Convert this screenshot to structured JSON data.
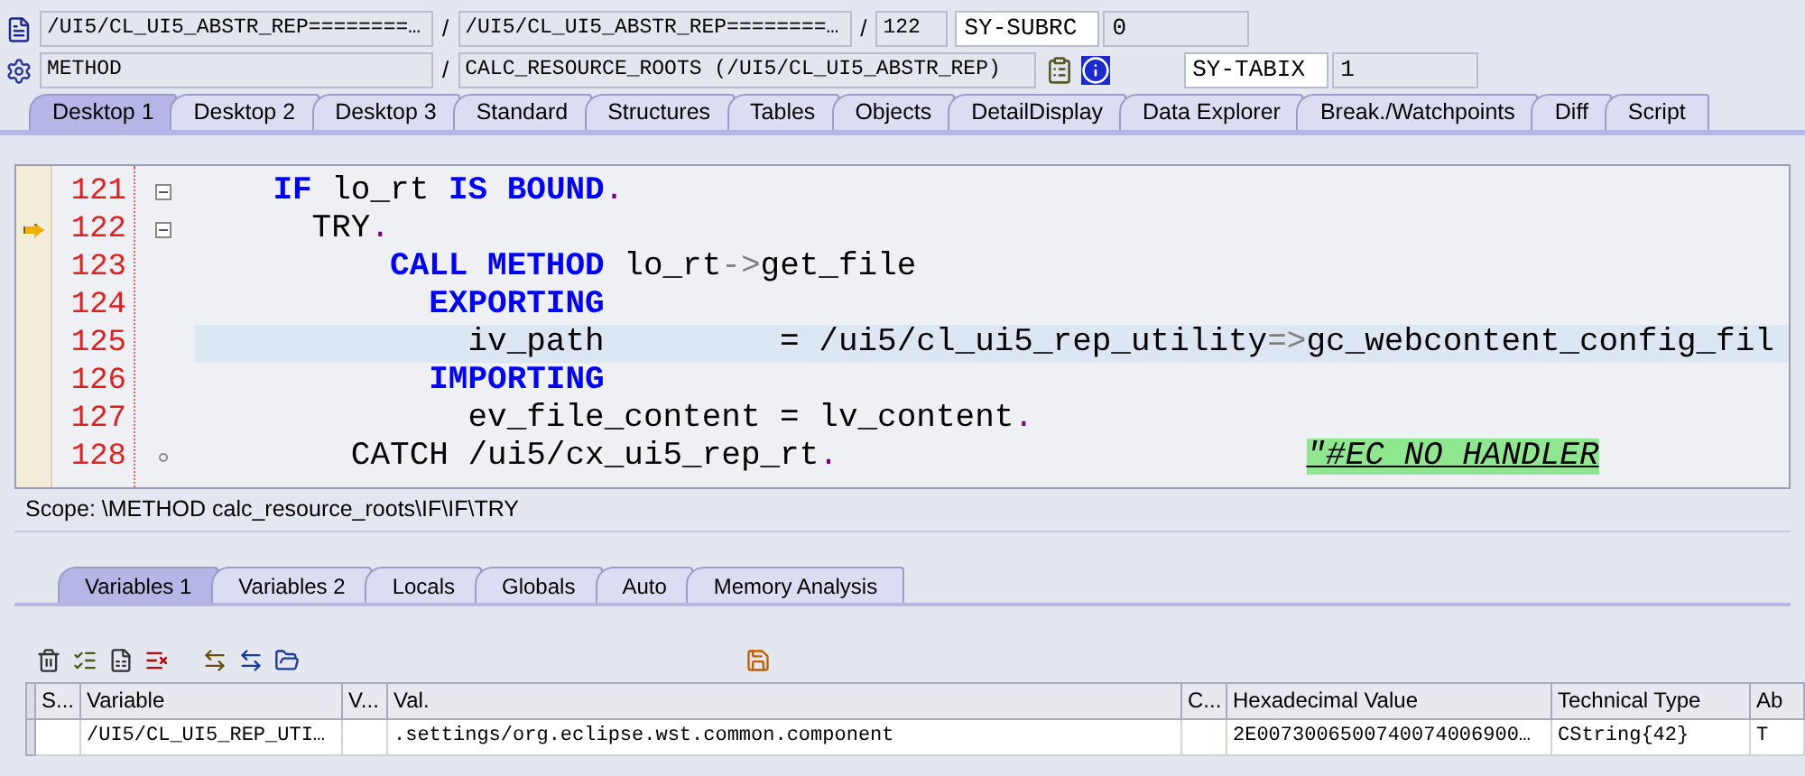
{
  "header": {
    "row1": [
      {
        "kind": "field",
        "text": "/UI5/CL_UI5_ABSTR_REP========…"
      },
      {
        "kind": "sep",
        "text": "/"
      },
      {
        "kind": "field",
        "text": "/UI5/CL_UI5_ABSTR_REP========…"
      },
      {
        "kind": "sep",
        "text": "/"
      },
      {
        "kind": "short",
        "text": "122"
      }
    ],
    "row2": [
      {
        "kind": "field",
        "text": "METHOD"
      },
      {
        "kind": "sep",
        "text": "/"
      },
      {
        "kind": "wide",
        "text": "CALC_RESOURCE_ROOTS (/UI5/CL_UI5_ABSTR_REP)"
      }
    ],
    "sysvars": [
      {
        "name": "SY-SUBRC",
        "value": "0"
      },
      {
        "name": "SY-TABIX",
        "value": "1"
      }
    ]
  },
  "tabs": [
    {
      "label": "Desktop 1",
      "selected": true
    },
    {
      "label": "Desktop 2",
      "selected": false
    },
    {
      "label": "Desktop 3",
      "selected": false
    },
    {
      "label": "Standard",
      "selected": false
    },
    {
      "label": "Structures",
      "selected": false
    },
    {
      "label": "Tables",
      "selected": false
    },
    {
      "label": "Objects",
      "selected": false
    },
    {
      "label": "DetailDisplay",
      "selected": false
    },
    {
      "label": "Data Explorer",
      "selected": false
    },
    {
      "label": "Break./Watchpoints",
      "selected": false
    },
    {
      "label": "Diff",
      "selected": false
    },
    {
      "label": "Script",
      "selected": false
    }
  ],
  "editor": {
    "lines": [
      {
        "number": "121",
        "highlighted": false,
        "foldable": true,
        "tokens": [
          {
            "kind": "kw",
            "text": "    IF"
          },
          {
            "kind": "id",
            "text": " lo_rt "
          },
          {
            "kind": "kw",
            "text": "IS BOUND"
          },
          {
            "kind": "dot",
            "text": "."
          }
        ]
      },
      {
        "number": "122",
        "current": true,
        "highlighted": false,
        "foldable": true,
        "tokens": [
          {
            "kind": "id",
            "text": "      TRY"
          },
          {
            "kind": "dot",
            "text": "."
          }
        ]
      },
      {
        "number": "123",
        "highlighted": false,
        "tokens": [
          {
            "kind": "kw",
            "text": "          CALL METHOD"
          },
          {
            "kind": "id",
            "text": " lo_rt"
          },
          {
            "kind": "op",
            "text": "->"
          },
          {
            "kind": "id",
            "text": "get_file"
          }
        ]
      },
      {
        "number": "124",
        "highlighted": false,
        "tokens": [
          {
            "kind": "kw",
            "text": "            EXPORTING"
          }
        ]
      },
      {
        "number": "125",
        "highlighted": true,
        "tokens": [
          {
            "kind": "id",
            "text": "              iv_path         = /ui5/cl_ui5_rep_utility"
          },
          {
            "kind": "op",
            "text": "=>"
          },
          {
            "kind": "id",
            "text": "gc_webcontent_config_fil"
          }
        ]
      },
      {
        "number": "126",
        "highlighted": false,
        "tokens": [
          {
            "kind": "kw",
            "text": "            IMPORTING"
          }
        ]
      },
      {
        "number": "127",
        "highlighted": false,
        "tokens": [
          {
            "kind": "id",
            "text": "              ev_file_content = lv_content"
          },
          {
            "kind": "dot",
            "text": "."
          }
        ]
      },
      {
        "number": "128",
        "highlighted": false,
        "block_end": true,
        "tokens": [
          {
            "kind": "id",
            "text": "        CATCH /ui5/cx_ui5_rep_rt"
          },
          {
            "kind": "dot",
            "text": "."
          },
          {
            "kind": "comment",
            "text": "                        \"#EC NO HANDLER"
          }
        ]
      }
    ]
  },
  "scope": "Scope: \\METHOD calc_resource_roots\\IF\\IF\\TRY",
  "var_tabs": [
    {
      "label": "Variables 1",
      "selected": true
    },
    {
      "label": "Variables 2",
      "selected": false
    },
    {
      "label": "Locals",
      "selected": false
    },
    {
      "label": "Globals",
      "selected": false
    },
    {
      "label": "Auto",
      "selected": false
    },
    {
      "label": "Memory Analysis",
      "selected": false
    }
  ],
  "table": {
    "columns": [
      "S...",
      "Variable",
      "V...",
      "Val.",
      "C...",
      "Hexadecimal Value",
      "Technical Type",
      "Ab"
    ],
    "rows": [
      {
        "selected": false,
        "cells": [
          "",
          "/UI5/CL_UI5_REP_UTI…",
          "",
          ".settings/org.eclipse.wst.common.component",
          "",
          "2E0073006500740074006900…",
          "CString{42}",
          "T"
        ]
      }
    ]
  }
}
